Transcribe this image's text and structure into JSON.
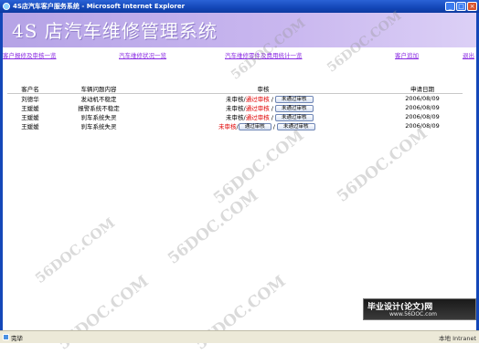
{
  "window": {
    "title": "4S店汽车客户服务系统 - Microsoft Internet Explorer",
    "minimize": "_",
    "maximize": "□",
    "close": "×"
  },
  "banner": {
    "title": "4S 店汽车维修管理系统"
  },
  "nav": {
    "items": [
      "客户报修及审核一览",
      "汽车维修状况一览",
      "汽车维修零件及费用统计一览",
      "客户追加",
      "退出"
    ]
  },
  "table": {
    "headers": [
      "客户名",
      "车辆问题内容",
      "审核",
      "申请日期"
    ],
    "rows": [
      {
        "name": "刘德华",
        "problem": "发动机不稳定",
        "status": "未审核",
        "pass": "通过审核",
        "reject": "未通过审核",
        "date": "2006/08/09"
      },
      {
        "name": "王媛媛",
        "problem": "报警系统不稳定",
        "status": "未审核",
        "pass": "通过审核",
        "reject": "未通过审核",
        "date": "2006/08/09"
      },
      {
        "name": "王媛媛",
        "problem": "刹车系统失灵",
        "status": "未审核",
        "pass": "通过审核",
        "reject": "未通过审核",
        "date": "2006/08/09"
      },
      {
        "name": "王媛媛",
        "problem": "刹车系统失灵",
        "status": "未审核",
        "pass": "通过审核",
        "reject": "未通过审核",
        "date": "2006/08/09"
      }
    ]
  },
  "watermarks": [
    "56DOC.COM",
    "56DOC.COM",
    "56DOC.COM",
    "56DOC.COM",
    "56DOC.COM",
    "56DOC.COM",
    "56DOC.COM",
    "56DOC.COM"
  ],
  "badge": {
    "line1": "毕业设计(论文)网",
    "line2": "www.56DOC.com"
  },
  "statusbar": {
    "text": "完毕",
    "zone": "本地 Intranet"
  },
  "colors": {
    "banner": "#c9b7ef",
    "nav_link": "#8a2be2",
    "warning": "#e00000",
    "titlebar": "#1447b8"
  }
}
